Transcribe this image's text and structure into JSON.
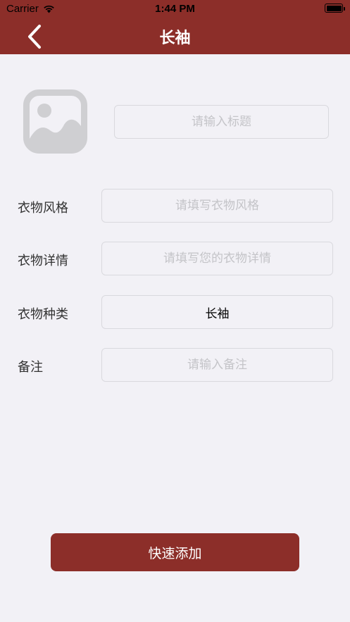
{
  "status_bar": {
    "carrier": "Carrier",
    "time": "1:44 PM"
  },
  "nav": {
    "title": "长袖",
    "back_icon": "chevron-left-icon"
  },
  "colors": {
    "primary": "#8c2e29",
    "background": "#f2f1f6",
    "placeholder": "#c4c4c8"
  },
  "image_picker": {
    "icon": "image-placeholder-icon"
  },
  "title_field": {
    "placeholder": "请输入标题",
    "value": ""
  },
  "form": {
    "style": {
      "label": "衣物风格",
      "placeholder": "请填写衣物风格",
      "value": ""
    },
    "details": {
      "label": "衣物详情",
      "placeholder": "请填写您的衣物详情",
      "value": ""
    },
    "category": {
      "label": "衣物种类",
      "placeholder": "",
      "value": "长袖"
    },
    "notes": {
      "label": "备注",
      "placeholder": "请输入备注",
      "value": ""
    }
  },
  "submit": {
    "label": "快速添加"
  }
}
